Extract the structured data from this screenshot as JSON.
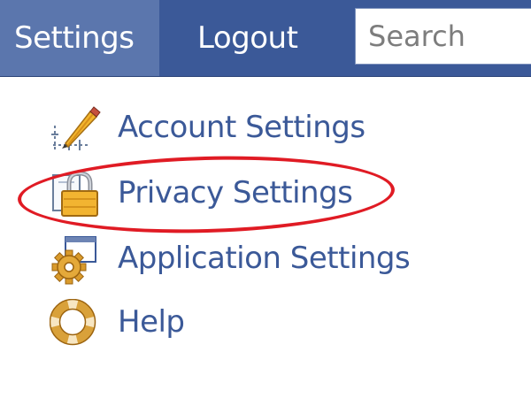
{
  "topbar": {
    "settings_label": "Settings",
    "logout_label": "Logout",
    "search_placeholder": "Search",
    "color": "#3b5998",
    "active_color": "#5b76ad"
  },
  "menu": {
    "items": [
      {
        "label": "Account Settings",
        "icon": "pencil-ruler-icon"
      },
      {
        "label": "Privacy Settings",
        "icon": "lock-icon"
      },
      {
        "label": "Application Settings",
        "icon": "application-gear-icon"
      },
      {
        "label": "Help",
        "icon": "lifebuoy-icon"
      }
    ],
    "label_color": "#3b5998"
  },
  "annotation": {
    "shape": "ellipse",
    "color": "#e01b24",
    "target": "Privacy Settings"
  }
}
